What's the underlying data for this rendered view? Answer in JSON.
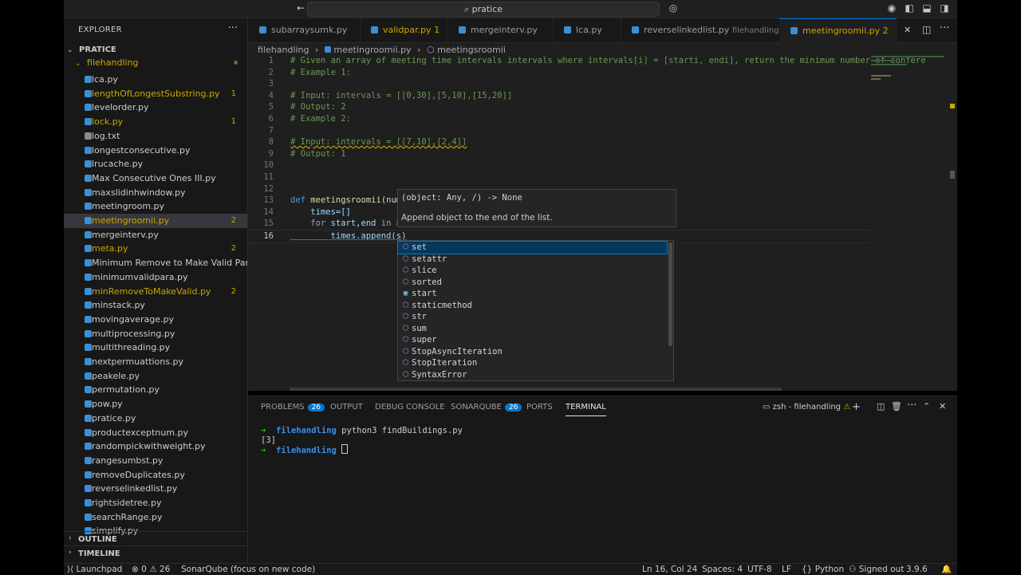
{
  "titlebar": {
    "search_text": "pratice",
    "icons": [
      "back-icon",
      "forward-icon",
      "search-icon",
      "copilot-icon",
      "account-icon",
      "toggle-sidebar-icon",
      "toggle-panel-icon",
      "toggle-secondary-sidebar-icon",
      "customize-layout-icon"
    ]
  },
  "sidebar": {
    "header": "EXPLORER",
    "more": "···",
    "root": "PRATICE",
    "folder": "filehandling",
    "files": [
      {
        "name": "lca.py",
        "color": "#cccccc",
        "badge": ""
      },
      {
        "name": "lengthOfLongestSubstring.py",
        "color": "#cca700",
        "badge": "1"
      },
      {
        "name": "levelorder.py",
        "color": "#cccccc",
        "badge": ""
      },
      {
        "name": "lock.py",
        "color": "#cca700",
        "badge": "1"
      },
      {
        "name": "log.txt",
        "color": "#cccccc",
        "badge": ""
      },
      {
        "name": "longestconsecutive.py",
        "color": "#cccccc",
        "badge": ""
      },
      {
        "name": "lrucache.py",
        "color": "#cccccc",
        "badge": ""
      },
      {
        "name": "Max Consecutive Ones III.py",
        "color": "#cccccc",
        "badge": ""
      },
      {
        "name": "maxslidinhwindow.py",
        "color": "#cccccc",
        "badge": ""
      },
      {
        "name": "meetingroom.py",
        "color": "#cccccc",
        "badge": ""
      },
      {
        "name": "meetingroomii.py",
        "color": "#cca700",
        "badge": "2",
        "selected": true
      },
      {
        "name": "mergeinterv.py",
        "color": "#cccccc",
        "badge": ""
      },
      {
        "name": "meta.py",
        "color": "#cca700",
        "badge": "2"
      },
      {
        "name": "Minimum Remove to Make Valid Paren...",
        "color": "#cccccc",
        "badge": ""
      },
      {
        "name": "minimumvalidpara.py",
        "color": "#cccccc",
        "badge": ""
      },
      {
        "name": "minRemoveToMakeValid.py",
        "color": "#cca700",
        "badge": "2"
      },
      {
        "name": "minstack.py",
        "color": "#cccccc",
        "badge": ""
      },
      {
        "name": "movingaverage.py",
        "color": "#cccccc",
        "badge": ""
      },
      {
        "name": "multiprocessing.py",
        "color": "#cccccc",
        "badge": ""
      },
      {
        "name": "multithreading.py",
        "color": "#cccccc",
        "badge": ""
      },
      {
        "name": "nextpermuattions.py",
        "color": "#cccccc",
        "badge": ""
      },
      {
        "name": "peakele.py",
        "color": "#cccccc",
        "badge": ""
      },
      {
        "name": "permutation.py",
        "color": "#cccccc",
        "badge": ""
      },
      {
        "name": "pow.py",
        "color": "#cccccc",
        "badge": ""
      },
      {
        "name": "pratice.py",
        "color": "#cccccc",
        "badge": ""
      },
      {
        "name": "productexceptnum.py",
        "color": "#cccccc",
        "badge": ""
      },
      {
        "name": "randompickwithweight.py",
        "color": "#cccccc",
        "badge": ""
      },
      {
        "name": "rangesumbst.py",
        "color": "#cccccc",
        "badge": ""
      },
      {
        "name": "removeDuplicates.py",
        "color": "#cccccc",
        "badge": ""
      },
      {
        "name": "reverselinkedlist.py",
        "color": "#cccccc",
        "badge": ""
      },
      {
        "name": "rightsidetree.py",
        "color": "#cccccc",
        "badge": ""
      },
      {
        "name": "searchRange.py",
        "color": "#cccccc",
        "badge": ""
      },
      {
        "name": "simplify.py",
        "color": "#cccccc",
        "badge": ""
      }
    ],
    "outline": "OUTLINE",
    "timeline": "TIMELINE"
  },
  "tabs": [
    {
      "label": "subarraysumk.py",
      "badge": "",
      "extra": "",
      "color": "#9d9d9d"
    },
    {
      "label": "validpar.py",
      "badge": "1",
      "extra": "",
      "color": "#cca700"
    },
    {
      "label": "mergeinterv.py",
      "badge": "",
      "extra": "",
      "color": "#9d9d9d"
    },
    {
      "label": "lca.py",
      "badge": "",
      "extra": "",
      "color": "#9d9d9d"
    },
    {
      "label": "reverselinkedlist.py",
      "badge": "",
      "extra": "filehandling",
      "color": "#9d9d9d"
    },
    {
      "label": "meetingroomii.py",
      "badge": "2",
      "extra": "",
      "color": "#cca700",
      "active": true
    }
  ],
  "breadcrumb": {
    "folder": "filehandling",
    "file": "meetingroomii.py",
    "symbol": "meetingsroomii",
    "sep": "›"
  },
  "code": [
    {
      "n": "1",
      "t": "# Given an array of meeting time intervals intervals where intervals[i] = [starti, endi], return the minimum number of confere",
      "c": "cmt"
    },
    {
      "n": "2",
      "t": "# Example 1:",
      "c": "cmt"
    },
    {
      "n": "3",
      "t": "",
      "c": "cmt"
    },
    {
      "n": "4",
      "t": "# Input: intervals = [[0,30],[5,10],[15,20]]",
      "c": "cmt"
    },
    {
      "n": "5",
      "t": "# Output: 2",
      "c": "cmt"
    },
    {
      "n": "6",
      "t": "# Example 2:",
      "c": "cmt"
    },
    {
      "n": "7",
      "t": "",
      "c": "cmt"
    },
    {
      "n": "8",
      "t": "# Input: intervals = [[7,10],[2,4]]",
      "c": "cmt"
    },
    {
      "n": "9",
      "t": "# Output: 1",
      "c": "cmt"
    },
    {
      "n": "10",
      "t": "",
      "c": "cmt"
    },
    {
      "n": "11",
      "t": "",
      "c": "cmt"
    },
    {
      "n": "12",
      "t": "",
      "c": "cmt"
    },
    {
      "n": "13",
      "t": "",
      "c": "def"
    },
    {
      "n": "14",
      "t": "    times=[]",
      "c": "var"
    },
    {
      "n": "15",
      "t": "",
      "c": "for"
    },
    {
      "n": "16",
      "t": "        times.append(s)",
      "c": "var",
      "current": true
    }
  ],
  "code_line13": {
    "kw": "def ",
    "fn": "meetingsroomii",
    "rest": "(nums"
  },
  "code_line15": {
    "kw": "    for ",
    "rest": "start,end ",
    "kw2": "in ",
    "rest2": "nu"
  },
  "hover": {
    "signature": "(object: Any, /) -> None",
    "description": "Append object to the end of the list."
  },
  "suggestions": [
    {
      "label": "set",
      "icon": "class-icon",
      "glyph": "⬡",
      "selected": true
    },
    {
      "label": "setattr",
      "icon": "method-icon",
      "glyph": "⬡"
    },
    {
      "label": "slice",
      "icon": "class-icon",
      "glyph": "⬡"
    },
    {
      "label": "sorted",
      "icon": "method-icon",
      "glyph": "⬡"
    },
    {
      "label": "start",
      "icon": "variable-icon",
      "glyph": "▣"
    },
    {
      "label": "staticmethod",
      "icon": "class-icon",
      "glyph": "⬡"
    },
    {
      "label": "str",
      "icon": "class-icon",
      "glyph": "⬡"
    },
    {
      "label": "sum",
      "icon": "method-icon",
      "glyph": "⬡"
    },
    {
      "label": "super",
      "icon": "class-icon",
      "glyph": "⬡"
    },
    {
      "label": "StopAsyncIteration",
      "icon": "class-icon",
      "glyph": "⬡"
    },
    {
      "label": "StopIteration",
      "icon": "class-icon",
      "glyph": "⬡"
    },
    {
      "label": "SyntaxError",
      "icon": "class-icon",
      "glyph": "⬡"
    }
  ],
  "panel": {
    "tabs": [
      {
        "label": "PROBLEMS",
        "badge": "26"
      },
      {
        "label": "OUTPUT",
        "badge": ""
      },
      {
        "label": "DEBUG CONSOLE",
        "badge": ""
      },
      {
        "label": "SONARQUBE",
        "badge": "26"
      },
      {
        "label": "PORTS",
        "badge": ""
      },
      {
        "label": "TERMINAL",
        "badge": "",
        "active": true
      }
    ],
    "terminal_name": "zsh - filehandling",
    "terminal": [
      {
        "prompt": "➜",
        "dir": "filehandling",
        "cmd": "python3 findBuildings.py"
      },
      {
        "output": "[3]"
      },
      {
        "prompt": "➜",
        "dir": "filehandling",
        "cmd": ""
      }
    ]
  },
  "status": {
    "remote": "Launchpad",
    "errors": "0",
    "warnings": "26",
    "sonar": "SonarQube (focus on new code)",
    "position": "Ln 16, Col 24",
    "spaces": "Spaces: 4",
    "encoding": "UTF-8",
    "eol": "LF",
    "language": "Python",
    "account": "Signed out",
    "version": "3.9.6"
  }
}
